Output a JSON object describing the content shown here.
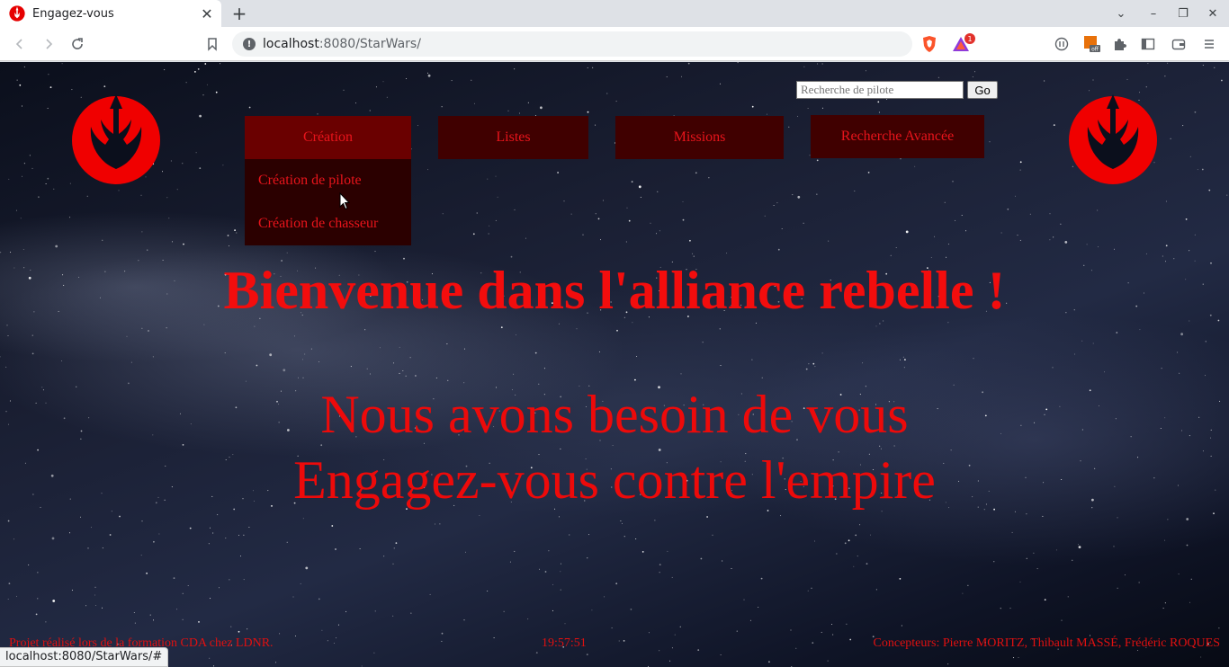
{
  "browser": {
    "tab_title": "Engagez-vous",
    "url_host": "localhost",
    "url_rest": ":8080/StarWars/",
    "rewards_badge": "1",
    "status_url": "localhost:8080/StarWars/#",
    "icons": {
      "back": "arrow-left-icon",
      "forward": "arrow-right-icon",
      "reload": "reload-icon",
      "bookmark": "bookmark-icon",
      "info": "info-icon",
      "extensions": "puzzle-icon",
      "sidebar": "sidebar-icon",
      "wallet": "wallet-icon",
      "menu": "hamburger-icon"
    }
  },
  "page": {
    "search": {
      "placeholder": "Recherche de pilote",
      "button": "Go"
    },
    "nav": {
      "creation": "Création",
      "listes": "Listes",
      "missions": "Missions",
      "recherche": "Recherche Avancée"
    },
    "dropdown": [
      "Création de pilote",
      "Création de chasseur"
    ],
    "headline": "Bienvenue dans l'alliance rebelle !",
    "tagline": [
      "Nous avons besoin de vous",
      "Engagez-vous contre l'empire"
    ],
    "footer": {
      "left": "Projet réalisé lors de la formation CDA chez LDNR.",
      "time": "19:57:51",
      "right": "Concepteurs: Pierre MORITZ, Thibault MASSÉ, Frédéric ROQUES"
    },
    "colors": {
      "accent_red": "#e8141b",
      "nav_bg": "#400000",
      "nav_active_bg": "#6a0000",
      "dropdown_bg": "#2b0000"
    }
  }
}
